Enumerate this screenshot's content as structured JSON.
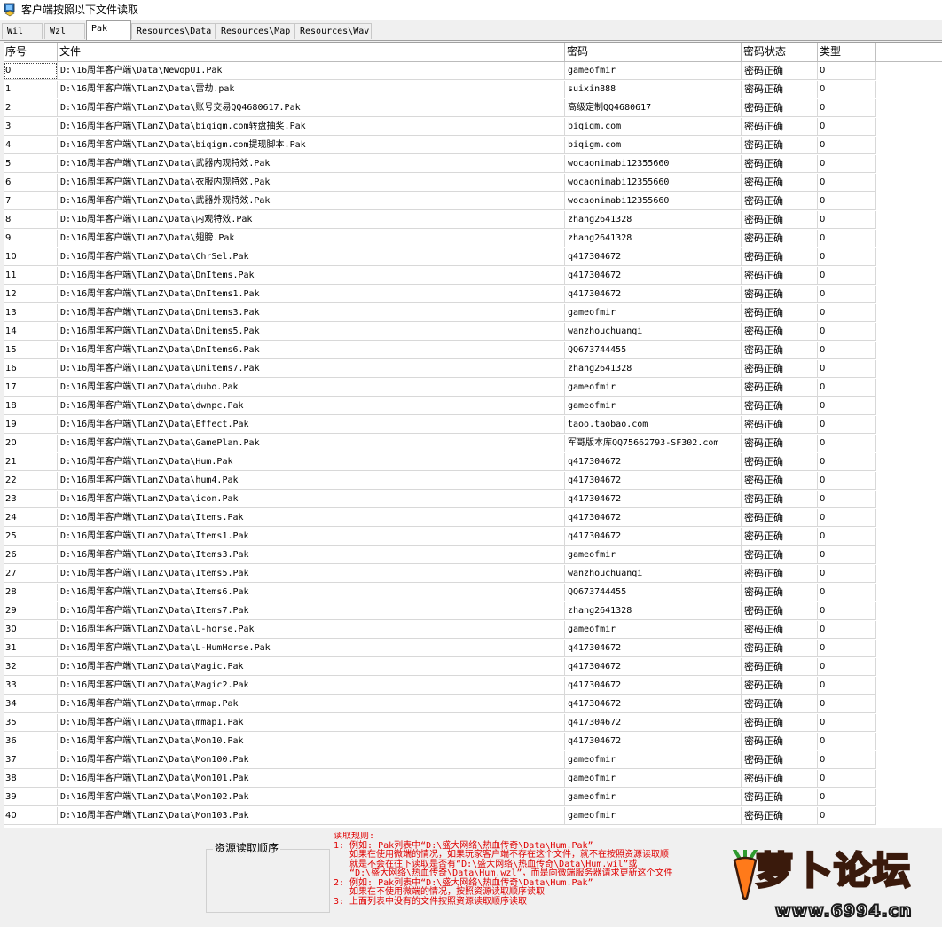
{
  "window": {
    "title": "客户端按照以下文件读取"
  },
  "tabs": [
    {
      "label": "Wil"
    },
    {
      "label": "Wzl"
    },
    {
      "label": "Pak",
      "active": true
    },
    {
      "label": "Resources\\Data"
    },
    {
      "label": "Resources\\Map"
    },
    {
      "label": "Resources\\Wav"
    }
  ],
  "table": {
    "columns": [
      "序号",
      "文件",
      "密码",
      "密码状态",
      "类型"
    ],
    "rows": [
      [
        "0",
        "D:\\16周年客户端\\Data\\NewopUI.Pak",
        "gameofmir",
        "密码正确",
        "0"
      ],
      [
        "1",
        "D:\\16周年客户端\\TLanZ\\Data\\雷劫.pak",
        "suixin888",
        "密码正确",
        "0"
      ],
      [
        "2",
        "D:\\16周年客户端\\TLanZ\\Data\\账号交易QQ4680617.Pak",
        "高级定制QQ4680617",
        "密码正确",
        "0"
      ],
      [
        "3",
        "D:\\16周年客户端\\TLanZ\\Data\\biqigm.com转盘抽奖.Pak",
        "biqigm.com",
        "密码正确",
        "0"
      ],
      [
        "4",
        "D:\\16周年客户端\\TLanZ\\Data\\biqigm.com提现脚本.Pak",
        "biqigm.com",
        "密码正确",
        "0"
      ],
      [
        "5",
        "D:\\16周年客户端\\TLanZ\\Data\\武器内观特效.Pak",
        "wocaonimabi12355660",
        "密码正确",
        "0"
      ],
      [
        "6",
        "D:\\16周年客户端\\TLanZ\\Data\\衣服内观特效.Pak",
        "wocaonimabi12355660",
        "密码正确",
        "0"
      ],
      [
        "7",
        "D:\\16周年客户端\\TLanZ\\Data\\武器外观特效.Pak",
        "wocaonimabi12355660",
        "密码正确",
        "0"
      ],
      [
        "8",
        "D:\\16周年客户端\\TLanZ\\Data\\内观特效.Pak",
        "zhang2641328",
        "密码正确",
        "0"
      ],
      [
        "9",
        "D:\\16周年客户端\\TLanZ\\Data\\翅膀.Pak",
        "zhang2641328",
        "密码正确",
        "0"
      ],
      [
        "10",
        "D:\\16周年客户端\\TLanZ\\Data\\ChrSel.Pak",
        "q417304672",
        "密码正确",
        "0"
      ],
      [
        "11",
        "D:\\16周年客户端\\TLanZ\\Data\\DnItems.Pak",
        "q417304672",
        "密码正确",
        "0"
      ],
      [
        "12",
        "D:\\16周年客户端\\TLanZ\\Data\\DnItems1.Pak",
        "q417304672",
        "密码正确",
        "0"
      ],
      [
        "13",
        "D:\\16周年客户端\\TLanZ\\Data\\Dnitems3.Pak",
        "gameofmir",
        "密码正确",
        "0"
      ],
      [
        "14",
        "D:\\16周年客户端\\TLanZ\\Data\\Dnitems5.Pak",
        "wanzhouchuanqi",
        "密码正确",
        "0"
      ],
      [
        "15",
        "D:\\16周年客户端\\TLanZ\\Data\\DnItems6.Pak",
        "QQ673744455",
        "密码正确",
        "0"
      ],
      [
        "16",
        "D:\\16周年客户端\\TLanZ\\Data\\Dnitems7.Pak",
        "zhang2641328",
        "密码正确",
        "0"
      ],
      [
        "17",
        "D:\\16周年客户端\\TLanZ\\Data\\dubo.Pak",
        "gameofmir",
        "密码正确",
        "0"
      ],
      [
        "18",
        "D:\\16周年客户端\\TLanZ\\Data\\dwnpc.Pak",
        "gameofmir",
        "密码正确",
        "0"
      ],
      [
        "19",
        "D:\\16周年客户端\\TLanZ\\Data\\Effect.Pak",
        "taoo.taobao.com",
        "密码正确",
        "0"
      ],
      [
        "20",
        "D:\\16周年客户端\\TLanZ\\Data\\GamePlan.Pak",
        "军哥版本库QQ75662793-SF302.com",
        "密码正确",
        "0"
      ],
      [
        "21",
        "D:\\16周年客户端\\TLanZ\\Data\\Hum.Pak",
        "q417304672",
        "密码正确",
        "0"
      ],
      [
        "22",
        "D:\\16周年客户端\\TLanZ\\Data\\hum4.Pak",
        "q417304672",
        "密码正确",
        "0"
      ],
      [
        "23",
        "D:\\16周年客户端\\TLanZ\\Data\\icon.Pak",
        "q417304672",
        "密码正确",
        "0"
      ],
      [
        "24",
        "D:\\16周年客户端\\TLanZ\\Data\\Items.Pak",
        "q417304672",
        "密码正确",
        "0"
      ],
      [
        "25",
        "D:\\16周年客户端\\TLanZ\\Data\\Items1.Pak",
        "q417304672",
        "密码正确",
        "0"
      ],
      [
        "26",
        "D:\\16周年客户端\\TLanZ\\Data\\Items3.Pak",
        "gameofmir",
        "密码正确",
        "0"
      ],
      [
        "27",
        "D:\\16周年客户端\\TLanZ\\Data\\Items5.Pak",
        "wanzhouchuanqi",
        "密码正确",
        "0"
      ],
      [
        "28",
        "D:\\16周年客户端\\TLanZ\\Data\\Items6.Pak",
        "QQ673744455",
        "密码正确",
        "0"
      ],
      [
        "29",
        "D:\\16周年客户端\\TLanZ\\Data\\Items7.Pak",
        "zhang2641328",
        "密码正确",
        "0"
      ],
      [
        "30",
        "D:\\16周年客户端\\TLanZ\\Data\\L-horse.Pak",
        "gameofmir",
        "密码正确",
        "0"
      ],
      [
        "31",
        "D:\\16周年客户端\\TLanZ\\Data\\L-HumHorse.Pak",
        "q417304672",
        "密码正确",
        "0"
      ],
      [
        "32",
        "D:\\16周年客户端\\TLanZ\\Data\\Magic.Pak",
        "q417304672",
        "密码正确",
        "0"
      ],
      [
        "33",
        "D:\\16周年客户端\\TLanZ\\Data\\Magic2.Pak",
        "q417304672",
        "密码正确",
        "0"
      ],
      [
        "34",
        "D:\\16周年客户端\\TLanZ\\Data\\mmap.Pak",
        "q417304672",
        "密码正确",
        "0"
      ],
      [
        "35",
        "D:\\16周年客户端\\TLanZ\\Data\\mmap1.Pak",
        "q417304672",
        "密码正确",
        "0"
      ],
      [
        "36",
        "D:\\16周年客户端\\TLanZ\\Data\\Mon10.Pak",
        "q417304672",
        "密码正确",
        "0"
      ],
      [
        "37",
        "D:\\16周年客户端\\TLanZ\\Data\\Mon100.Pak",
        "gameofmir",
        "密码正确",
        "0"
      ],
      [
        "38",
        "D:\\16周年客户端\\TLanZ\\Data\\Mon101.Pak",
        "gameofmir",
        "密码正确",
        "0"
      ],
      [
        "39",
        "D:\\16周年客户端\\TLanZ\\Data\\Mon102.Pak",
        "gameofmir",
        "密码正确",
        "0"
      ],
      [
        "40",
        "D:\\16周年客户端\\TLanZ\\Data\\Mon103.Pak",
        "gameofmir",
        "密码正确",
        "0"
      ]
    ]
  },
  "bottom": {
    "order_label": "资源读取顺序",
    "rules_lines": [
      "读取规则:",
      "1: 例如: Pak列表中“D:\\盛大网络\\热血传奇\\Data\\Hum.Pak”",
      "   如果在使用微端的情况，如果玩家客户端不存在这个文件，就不在按照资源读取顺",
      "   就是不会在往下读取是否有“D:\\盛大网络\\热血传奇\\Data\\Hum.wil”或",
      "   “D:\\盛大网络\\热血传奇\\Data\\Hum.wzl”，而是向微端服务器请求更新这个文件",
      "2: 例如: Pak列表中“D:\\盛大网络\\热血传奇\\Data\\Hum.Pak”",
      "   如果在不使用微端的情况，按照资源读取顺序读取",
      "3: 上面列表中没有的文件按照资源读取顺序读取"
    ]
  },
  "watermark": {
    "brand": "萝卜论坛",
    "url": "www.6994.cn"
  },
  "colors": {
    "rules_text": "#e00000",
    "logo_fill": "#ffd23a",
    "logo_outline": "#3a1a0c"
  }
}
